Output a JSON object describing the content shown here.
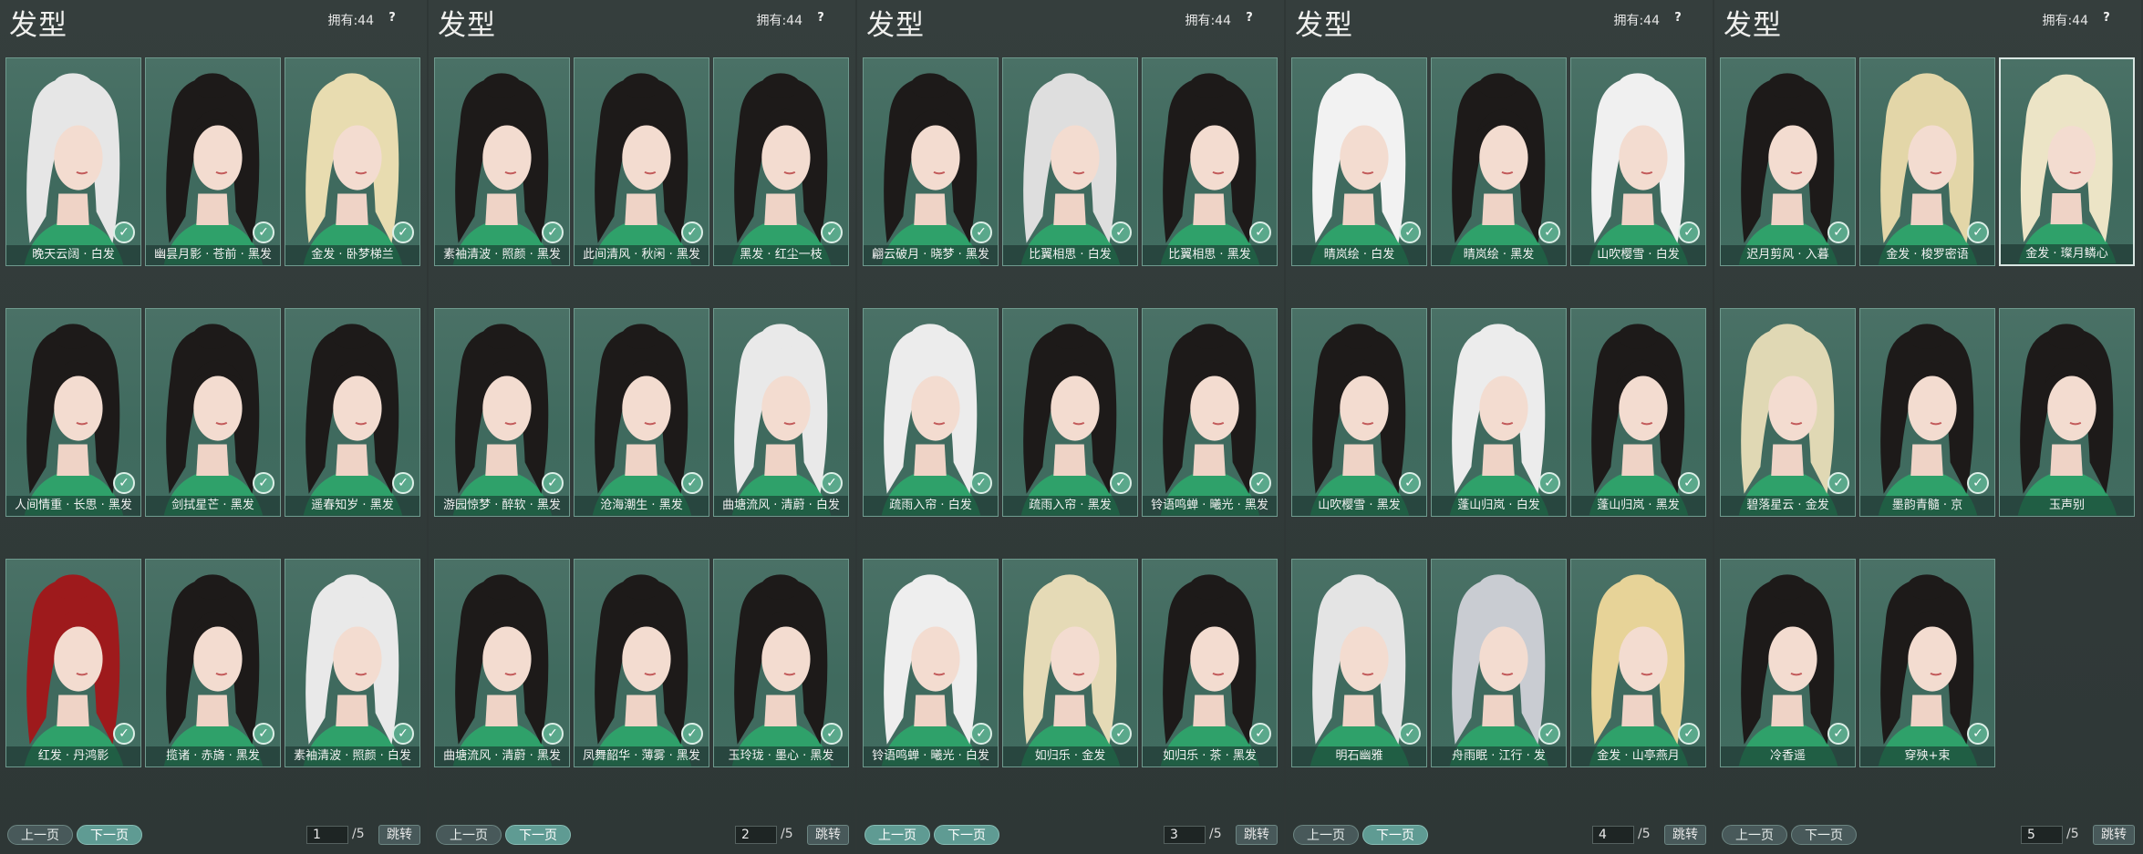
{
  "colors": {
    "background": "#2f3736",
    "card": "#4a7166",
    "active_button": "#5f9b93",
    "check_badge": "#5aa88b"
  },
  "panels": [
    {
      "title": "发型",
      "owned": "拥有:44",
      "help": "?",
      "prev": "上一页",
      "next": "下一页",
      "page": "1",
      "total": "/5",
      "jump": "跳转",
      "active_nav": "next",
      "items": [
        {
          "label": "晚天云阔 · 白发",
          "hair": "#e6e6e6",
          "check": true
        },
        {
          "label": "幽昙月影 · 苍前 · 黑发",
          "hair": "#1d1a19",
          "check": true
        },
        {
          "label": "金发 · 卧梦梯兰",
          "hair": "#e8dcb0",
          "check": true
        },
        {
          "label": "人间情重 · 长思 · 黑发",
          "hair": "#1d1a19",
          "check": true
        },
        {
          "label": "剑拭星芒 · 黑发",
          "hair": "#1d1a19",
          "check": true
        },
        {
          "label": "遥春知岁 · 黑发",
          "hair": "#1d1a19",
          "check": true
        },
        {
          "label": "红发 · 丹鸿影",
          "hair": "#9e1a1c",
          "check": true
        },
        {
          "label": "揽诸 · 赤旖 · 黑发",
          "hair": "#1d1a19",
          "check": true
        },
        {
          "label": "素袖清波 · 照颜 · 白发",
          "hair": "#e9e9e9",
          "check": true
        }
      ]
    },
    {
      "title": "发型",
      "owned": "拥有:44",
      "help": "?",
      "prev": "上一页",
      "next": "下一页",
      "page": "2",
      "total": "/5",
      "jump": "跳转",
      "active_nav": "next",
      "items": [
        {
          "label": "素袖清波 · 照颜 · 黑发",
          "hair": "#1d1a19",
          "check": true
        },
        {
          "label": "此间清风 · 秋闲 · 黑发",
          "hair": "#1d1a19",
          "check": true
        },
        {
          "label": "黑发 · 红尘一枝",
          "hair": "#1d1a19",
          "check": true
        },
        {
          "label": "游园惊梦 · 醉软 · 黑发",
          "hair": "#1d1a19",
          "check": true
        },
        {
          "label": "沧海潮生 · 黑发",
          "hair": "#1d1a19",
          "check": true
        },
        {
          "label": "曲塘流风 · 清蔚 · 白发",
          "hair": "#e9e9e9",
          "check": true
        },
        {
          "label": "曲塘流风 · 清蔚 · 黑发",
          "hair": "#1d1a19",
          "check": true
        },
        {
          "label": "凤舞韶华 · 薄雾 · 黑发",
          "hair": "#1d1a19",
          "check": true
        },
        {
          "label": "玉玲珑 · 墨心 · 黑发",
          "hair": "#1d1a19",
          "check": true
        }
      ]
    },
    {
      "title": "发型",
      "owned": "拥有:44",
      "help": "?",
      "prev": "上一页",
      "next": "下一页",
      "page": "3",
      "total": "/5",
      "jump": "跳转",
      "active_nav": "both",
      "items": [
        {
          "label": "翩云破月 · 晓梦 · 黑发",
          "hair": "#1d1a19",
          "check": true
        },
        {
          "label": "比翼相思 · 白发",
          "hair": "#dedede",
          "check": true
        },
        {
          "label": "比翼相思 · 黑发",
          "hair": "#1d1a19",
          "check": true
        },
        {
          "label": "疏雨入帘 · 白发",
          "hair": "#ececec",
          "check": true
        },
        {
          "label": "疏雨入帘 · 黑发",
          "hair": "#1d1a19",
          "check": true
        },
        {
          "label": "铃语鸣蝉 · 曦光 · 黑发",
          "hair": "#1d1a19",
          "check": true
        },
        {
          "label": "铃语鸣蝉 · 曦光 · 白发",
          "hair": "#eeeeee",
          "check": true
        },
        {
          "label": "如归乐 · 金发",
          "hair": "#e5dab6",
          "check": true
        },
        {
          "label": "如归乐 · 茶 · 黑发",
          "hair": "#1d1a19",
          "check": true
        }
      ]
    },
    {
      "title": "发型",
      "owned": "拥有:44",
      "help": "?",
      "prev": "上一页",
      "next": "下一页",
      "page": "4",
      "total": "/5",
      "jump": "跳转",
      "active_nav": "next",
      "items": [
        {
          "label": "晴岚绘 · 白发",
          "hair": "#f2f2f2",
          "check": true
        },
        {
          "label": "晴岚绘 · 黑发",
          "hair": "#1d1a19",
          "check": true
        },
        {
          "label": "山吹樱雪 · 白发",
          "hair": "#f0f0f0",
          "check": true
        },
        {
          "label": "山吹樱雪 · 黑发",
          "hair": "#1d1a19",
          "check": true
        },
        {
          "label": "蓬山归岚 · 白发",
          "hair": "#ececec",
          "check": true
        },
        {
          "label": "蓬山归岚 · 黑发",
          "hair": "#1d1a19",
          "check": true
        },
        {
          "label": "明石幽雅",
          "hair": "#e4e4e4",
          "check": true
        },
        {
          "label": "舟雨眠 · 江行 · 发",
          "hair": "#c9ccd2",
          "check": true
        },
        {
          "label": "金发 · 山亭燕月",
          "hair": "#e7d398",
          "check": true
        }
      ]
    },
    {
      "title": "发型",
      "owned": "拥有:44",
      "help": "?",
      "prev": "上一页",
      "next": "下一页",
      "page": "5",
      "total": "/5",
      "jump": "跳转",
      "active_nav": "none",
      "items": [
        {
          "label": "迟月剪风 · 入暮",
          "hair": "#1d1a19",
          "check": true
        },
        {
          "label": "金发 · 梭罗密语",
          "hair": "#e3d6a8",
          "check": true
        },
        {
          "label": "金发 · 璨月鳞心",
          "hair": "#ece4c6",
          "check": false,
          "selected": true
        },
        {
          "label": "碧落星云 · 金发",
          "hair": "#e0d8b4",
          "check": true
        },
        {
          "label": "墨韵青髓 · 京",
          "hair": "#1d1a19",
          "check": true
        },
        {
          "label": "玉声别",
          "hair": "#1d1a19",
          "check": false
        },
        {
          "label": "冷香遥",
          "hair": "#1d1a19",
          "check": true
        },
        {
          "label": "穿殃+束",
          "hair": "#1d1a19",
          "check": true
        }
      ]
    }
  ]
}
